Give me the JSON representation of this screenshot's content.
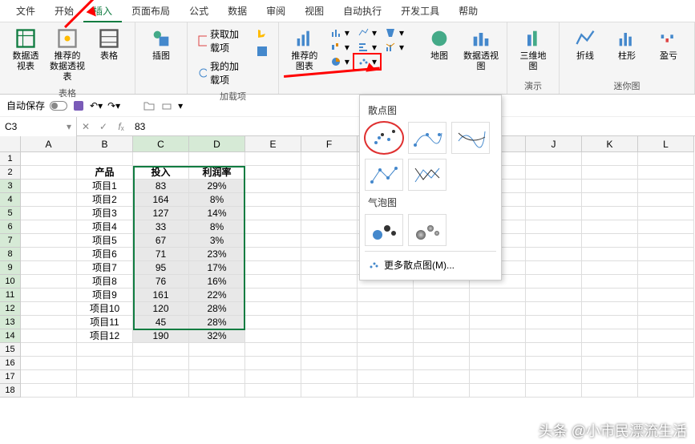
{
  "menu": [
    "文件",
    "开始",
    "插入",
    "页面布局",
    "公式",
    "数据",
    "审阅",
    "视图",
    "自动执行",
    "开发工具",
    "帮助"
  ],
  "active_menu": 2,
  "ribbon": {
    "groups": [
      {
        "label": "表格",
        "buttons": [
          {
            "name": "pivot-table",
            "label": "数据透\n视表"
          },
          {
            "name": "recommended-pivot",
            "label": "推荐的\n数据透视表"
          },
          {
            "name": "table",
            "label": "表格"
          }
        ]
      },
      {
        "label": "",
        "buttons": [
          {
            "name": "illustrations",
            "label": "插图"
          }
        ]
      },
      {
        "label": "加载项",
        "small": [
          {
            "name": "get-addins",
            "label": "获取加载项"
          },
          {
            "name": "my-addins",
            "label": "我的加载项"
          }
        ],
        "side": [
          {
            "name": "bing",
            "label": ""
          },
          {
            "name": "visio",
            "label": ""
          }
        ]
      },
      {
        "label": "",
        "buttons": [
          {
            "name": "recommended-charts",
            "label": "推荐的\n图表"
          }
        ]
      },
      {
        "label": "",
        "small_icons": [
          "column-chart-icon",
          "line-chart-icon",
          "pie-chart-icon",
          "bar-chart-icon",
          "area-chart-icon",
          "scatter-chart-icon",
          "waterfall-chart-icon",
          "funnel-chart-icon",
          "combo-chart-icon"
        ]
      },
      {
        "label": "",
        "buttons": [
          {
            "name": "map",
            "label": "地图"
          },
          {
            "name": "pivot-chart",
            "label": "数据透视图"
          }
        ]
      },
      {
        "label": "演示",
        "buttons": [
          {
            "name": "3d-map",
            "label": "三维地\n图"
          }
        ]
      },
      {
        "label": "迷你图",
        "buttons": [
          {
            "name": "sparkline-line",
            "label": "折线"
          },
          {
            "name": "sparkline-column",
            "label": "柱形"
          },
          {
            "name": "sparkline-winloss",
            "label": "盈亏"
          }
        ]
      }
    ]
  },
  "qat": {
    "autosave": "自动保存"
  },
  "namebox": "C3",
  "formula": "83",
  "columns": [
    "A",
    "B",
    "C",
    "D",
    "E",
    "F",
    "G",
    "H",
    "I",
    "J",
    "K",
    "L"
  ],
  "rows": 18,
  "selected_cols": [
    2,
    3
  ],
  "selected_rows_start": 3,
  "selected_rows_end": 14,
  "data": {
    "headers": {
      "b": "产品",
      "c": "投入",
      "d": "利润率"
    },
    "rows": [
      {
        "b": "项目1",
        "c": "83",
        "d": "29%"
      },
      {
        "b": "项目2",
        "c": "164",
        "d": "8%"
      },
      {
        "b": "项目3",
        "c": "127",
        "d": "14%"
      },
      {
        "b": "项目4",
        "c": "33",
        "d": "8%"
      },
      {
        "b": "项目5",
        "c": "67",
        "d": "3%"
      },
      {
        "b": "项目6",
        "c": "71",
        "d": "23%"
      },
      {
        "b": "项目7",
        "c": "95",
        "d": "17%"
      },
      {
        "b": "项目8",
        "c": "76",
        "d": "16%"
      },
      {
        "b": "项目9",
        "c": "161",
        "d": "22%"
      },
      {
        "b": "项目10",
        "c": "120",
        "d": "28%"
      },
      {
        "b": "项目11",
        "c": "45",
        "d": "28%"
      },
      {
        "b": "项目12",
        "c": "190",
        "d": "32%"
      }
    ]
  },
  "dropdown": {
    "section1": "散点图",
    "section2": "气泡图",
    "more": "更多散点图(M)..."
  },
  "watermark": "头条 @小市民漂流生活"
}
